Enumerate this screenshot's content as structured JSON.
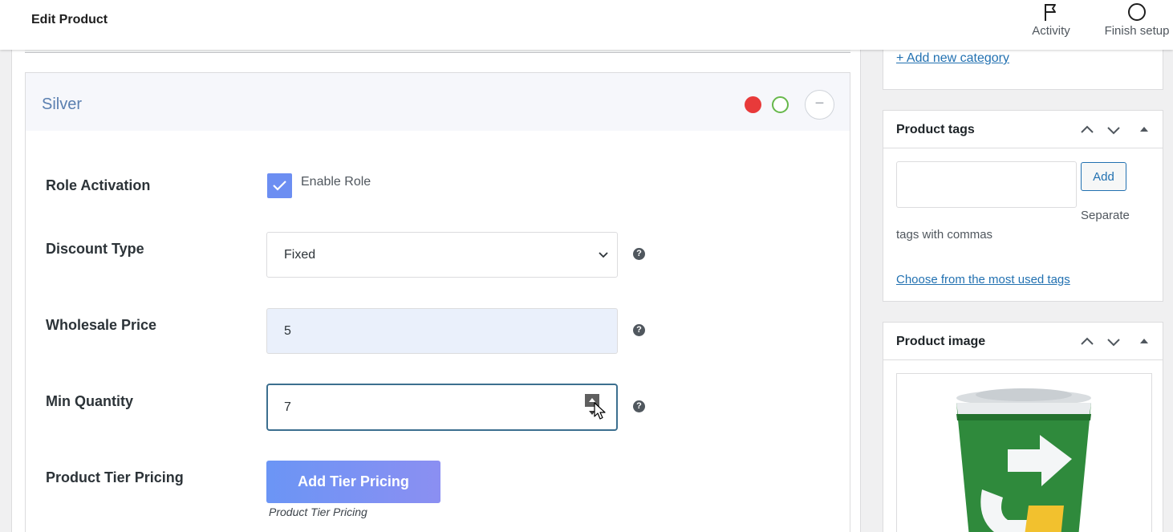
{
  "header": {
    "title": "Edit Product",
    "actions": [
      {
        "label": "Activity",
        "icon": "flag-icon"
      },
      {
        "label": "Finish setup",
        "icon": "circle-icon"
      }
    ]
  },
  "role_card": {
    "name": "Silver",
    "fields": {
      "role_activation": {
        "label": "Role Activation",
        "checkbox_label": "Enable Role",
        "checked": true
      },
      "discount_type": {
        "label": "Discount Type",
        "value": "Fixed"
      },
      "wholesale_price": {
        "label": "Wholesale Price",
        "value": "5"
      },
      "min_quantity": {
        "label": "Min Quantity",
        "value": "7"
      },
      "tier_pricing": {
        "label": "Product Tier Pricing",
        "button_label": "Add Tier Pricing",
        "hint": "Product Tier Pricing"
      }
    },
    "help_glyph": "?"
  },
  "sidebar": {
    "categories": {
      "add_link": "+ Add new category"
    },
    "tags": {
      "title": "Product tags",
      "add_button": "Add",
      "help_line1": "Separate",
      "help_line2": "tags with commas",
      "choose_link": "Choose from the most used tags"
    },
    "image": {
      "title": "Product image"
    }
  },
  "colors": {
    "accent_link": "#2271b1",
    "role_name": "#5a7fb0",
    "status_red": "#e83a3a",
    "status_green": "#67b84b",
    "button_gradient_start": "#6b95f5",
    "button_gradient_end": "#8b8ff2"
  }
}
